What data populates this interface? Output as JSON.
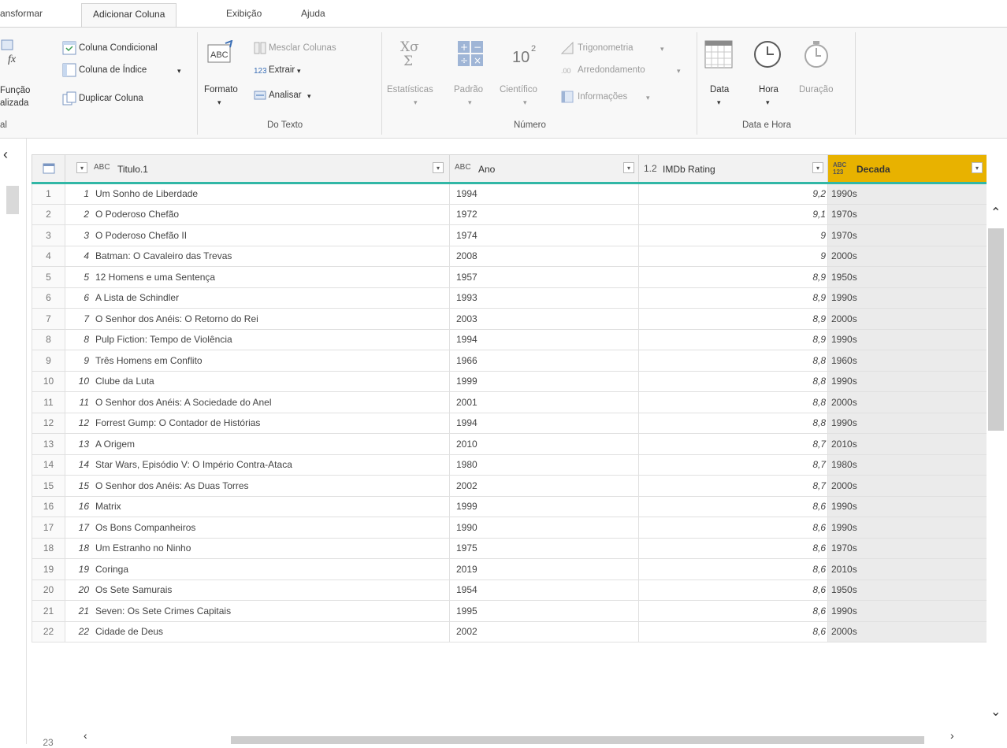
{
  "tabs": [
    "ansformar",
    "Adicionar Coluna",
    "Exibição",
    "Ajuda"
  ],
  "ribbon": {
    "geral": {
      "func_label_1": "Função",
      "func_label_2": "alizada",
      "group_label": "al"
    },
    "colunas": {
      "conditional": "Coluna Condicional",
      "index": "Coluna de Índice",
      "duplicate": "Duplicar Coluna"
    },
    "texto": {
      "format": "Formato",
      "merge": "Mesclar Colunas",
      "extract": "Extrair",
      "parse": "Analisar",
      "group_label": "Do Texto"
    },
    "numero": {
      "statistics": "Estatísticas",
      "standard": "Padrão",
      "scientific": "Científico",
      "trig": "Trigonometria",
      "rounding": "Arredondamento",
      "info": "Informações",
      "group_label": "Número"
    },
    "data_hora": {
      "date": "Data",
      "time": "Hora",
      "duration": "Duração",
      "group_label": "Data e Hora"
    }
  },
  "grid": {
    "headers": [
      {
        "type": "ABC",
        "label": "Titulo.1"
      },
      {
        "type": "ABC",
        "label": "Ano"
      },
      {
        "type": "1.2",
        "label": "IMDb Rating"
      },
      {
        "type": "ABC 123",
        "label": "Decada"
      }
    ],
    "rows": [
      {
        "n": "1",
        "idx": "1",
        "title": "Um Sonho de Liberdade",
        "year": "1994",
        "rating": "9,2",
        "decade": "1990s"
      },
      {
        "n": "2",
        "idx": "2",
        "title": "O Poderoso Chefão",
        "year": "1972",
        "rating": "9,1",
        "decade": "1970s"
      },
      {
        "n": "3",
        "idx": "3",
        "title": "O Poderoso Chefão II",
        "year": "1974",
        "rating": "9",
        "decade": "1970s"
      },
      {
        "n": "4",
        "idx": "4",
        "title": "Batman: O Cavaleiro das Trevas",
        "year": "2008",
        "rating": "9",
        "decade": "2000s"
      },
      {
        "n": "5",
        "idx": "5",
        "title": "12 Homens e uma Sentença",
        "year": "1957",
        "rating": "8,9",
        "decade": "1950s"
      },
      {
        "n": "6",
        "idx": "6",
        "title": "A Lista de Schindler",
        "year": "1993",
        "rating": "8,9",
        "decade": "1990s"
      },
      {
        "n": "7",
        "idx": "7",
        "title": "O Senhor dos Anéis: O Retorno do Rei",
        "year": "2003",
        "rating": "8,9",
        "decade": "2000s"
      },
      {
        "n": "8",
        "idx": "8",
        "title": "Pulp Fiction: Tempo de Violência",
        "year": "1994",
        "rating": "8,9",
        "decade": "1990s"
      },
      {
        "n": "9",
        "idx": "9",
        "title": "Três Homens em Conflito",
        "year": "1966",
        "rating": "8,8",
        "decade": "1960s"
      },
      {
        "n": "10",
        "idx": "10",
        "title": "Clube da Luta",
        "year": "1999",
        "rating": "8,8",
        "decade": "1990s"
      },
      {
        "n": "11",
        "idx": "11",
        "title": "O Senhor dos Anéis: A Sociedade do Anel",
        "year": "2001",
        "rating": "8,8",
        "decade": "2000s"
      },
      {
        "n": "12",
        "idx": "12",
        "title": "Forrest Gump: O Contador de Histórias",
        "year": "1994",
        "rating": "8,8",
        "decade": "1990s"
      },
      {
        "n": "13",
        "idx": "13",
        "title": "A Origem",
        "year": "2010",
        "rating": "8,7",
        "decade": "2010s"
      },
      {
        "n": "14",
        "idx": "14",
        "title": "Star Wars, Episódio V: O Império Contra-Ataca",
        "year": "1980",
        "rating": "8,7",
        "decade": "1980s"
      },
      {
        "n": "15",
        "idx": "15",
        "title": "O Senhor dos Anéis: As Duas Torres",
        "year": "2002",
        "rating": "8,7",
        "decade": "2000s"
      },
      {
        "n": "16",
        "idx": "16",
        "title": "Matrix",
        "year": "1999",
        "rating": "8,6",
        "decade": "1990s"
      },
      {
        "n": "17",
        "idx": "17",
        "title": "Os Bons Companheiros",
        "year": "1990",
        "rating": "8,6",
        "decade": "1990s"
      },
      {
        "n": "18",
        "idx": "18",
        "title": "Um Estranho no Ninho",
        "year": "1975",
        "rating": "8,6",
        "decade": "1970s"
      },
      {
        "n": "19",
        "idx": "19",
        "title": "Coringa",
        "year": "2019",
        "rating": "8,6",
        "decade": "2010s"
      },
      {
        "n": "20",
        "idx": "20",
        "title": "Os Sete Samurais",
        "year": "1954",
        "rating": "8,6",
        "decade": "1950s"
      },
      {
        "n": "21",
        "idx": "21",
        "title": "Seven: Os Sete Crimes Capitais",
        "year": "1995",
        "rating": "8,6",
        "decade": "1990s"
      },
      {
        "n": "22",
        "idx": "22",
        "title": "Cidade de Deus",
        "year": "2002",
        "rating": "8,6",
        "decade": "2000s"
      }
    ],
    "partial_row_number": "23"
  }
}
